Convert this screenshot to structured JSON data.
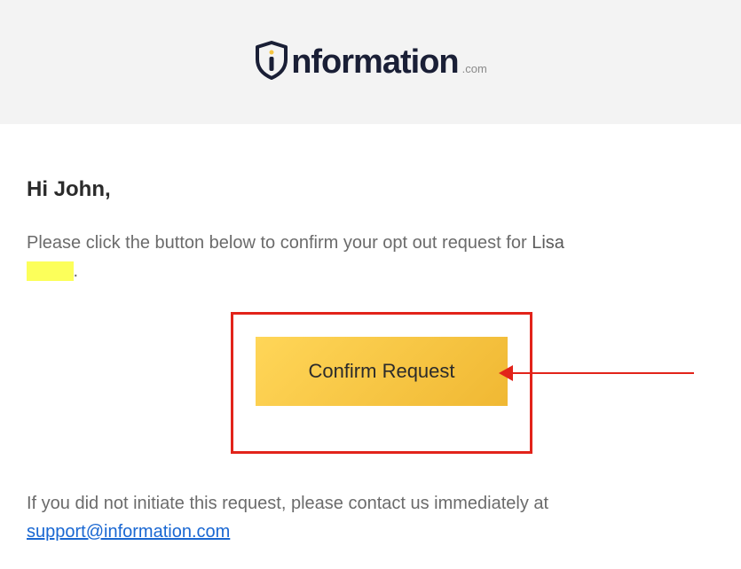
{
  "logo": {
    "brand_text": "nformation",
    "suffix": ".com"
  },
  "email": {
    "greeting": "Hi John,",
    "body_prefix": "Please click the button below to confirm your opt out request for ",
    "name_first": "Lisa",
    "name_redacted": "____",
    "body_suffix": ".",
    "button_label": "Confirm Request",
    "footer_text": "If you did not initiate this request, please contact us immediately at",
    "support_email": "support@information.com"
  }
}
